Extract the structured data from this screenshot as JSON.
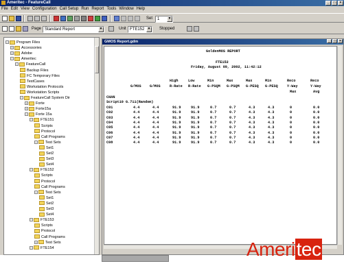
{
  "window": {
    "title": "Ameritec - FeatureCall"
  },
  "menu": [
    "File",
    "Edit",
    "View",
    "Configuration",
    "Call Setup",
    "Run",
    "Report",
    "Tools",
    "Window",
    "Help"
  ],
  "toolbar1": {
    "set_label": "Set",
    "set_value": "1"
  },
  "toolbar2": {
    "page_label": "Page",
    "page_value": "Standard Report",
    "unit_label": "Unit",
    "unit_value": "FTE152",
    "status": "Stopped"
  },
  "tree": {
    "items": [
      {
        "label": "Program Files",
        "indent": 1,
        "pm": "-"
      },
      {
        "label": "Accessories",
        "indent": 2,
        "pm": "+"
      },
      {
        "label": "Adobe",
        "indent": 2,
        "pm": "+"
      },
      {
        "label": "Ameritec",
        "indent": 2,
        "pm": "-"
      },
      {
        "label": "FeatureCall",
        "indent": 3,
        "pm": "-"
      },
      {
        "label": "Backup Files",
        "indent": 4,
        "pm": ""
      },
      {
        "label": "FC Temporary Files",
        "indent": 4,
        "pm": ""
      },
      {
        "label": "TestCases",
        "indent": 4,
        "pm": ""
      },
      {
        "label": "Workstation Protocols",
        "indent": 4,
        "pm": ""
      },
      {
        "label": "Workstation Scripts",
        "indent": 4,
        "pm": ""
      },
      {
        "label": "FeatureCall System Dir",
        "indent": 4,
        "pm": "-"
      },
      {
        "label": "Forte",
        "indent": 5,
        "pm": "+"
      },
      {
        "label": "Forte15a",
        "indent": 5,
        "pm": "+"
      },
      {
        "label": "Forte 15a",
        "indent": 5,
        "pm": "-"
      },
      {
        "label": "FTE151",
        "indent": 6,
        "pm": "-"
      },
      {
        "label": "Scripts",
        "indent": 7,
        "pm": ""
      },
      {
        "label": "Protocol",
        "indent": 7,
        "pm": ""
      },
      {
        "label": "Call Programs",
        "indent": 7,
        "pm": ""
      },
      {
        "label": "Test Sets",
        "indent": 7,
        "pm": "-"
      },
      {
        "label": "Set1",
        "indent": 8,
        "pm": ""
      },
      {
        "label": "Set2",
        "indent": 8,
        "pm": ""
      },
      {
        "label": "Set3",
        "indent": 8,
        "pm": ""
      },
      {
        "label": "Set4",
        "indent": 8,
        "pm": ""
      },
      {
        "label": "FTE152",
        "indent": 6,
        "pm": "-"
      },
      {
        "label": "Scripts",
        "indent": 7,
        "pm": ""
      },
      {
        "label": "Protocol",
        "indent": 7,
        "pm": ""
      },
      {
        "label": "Call Programs",
        "indent": 7,
        "pm": ""
      },
      {
        "label": "Test Sets",
        "indent": 7,
        "pm": "-"
      },
      {
        "label": "Set1",
        "indent": 8,
        "pm": ""
      },
      {
        "label": "Set2",
        "indent": 8,
        "pm": ""
      },
      {
        "label": "Set3",
        "indent": 8,
        "pm": ""
      },
      {
        "label": "Set4",
        "indent": 8,
        "pm": ""
      },
      {
        "label": "FTE153",
        "indent": 6,
        "pm": "-"
      },
      {
        "label": "Scripts",
        "indent": 7,
        "pm": ""
      },
      {
        "label": "Protocol",
        "indent": 7,
        "pm": ""
      },
      {
        "label": "Call Programs",
        "indent": 7,
        "pm": ""
      },
      {
        "label": "Test Sets",
        "indent": 7,
        "pm": "+"
      },
      {
        "label": "FTE154",
        "indent": 6,
        "pm": "-"
      }
    ]
  },
  "report": {
    "window_title": "GMOS Report.gdm",
    "heading": "GoldenMOS REPORT",
    "unit": "FTE152",
    "date": "Friday, August 09, 2002, 11:42:12",
    "columns": [
      {
        "l1": "",
        "l2": "",
        "l3": "G/MOS"
      },
      {
        "l1": "",
        "l2": "",
        "l3": "G/MOS"
      },
      {
        "l1": "High",
        "l2": "",
        "l3": "R-Rate"
      },
      {
        "l1": "Low",
        "l2": "",
        "l3": "R-Rate"
      },
      {
        "l1": "Min",
        "l2": "",
        "l3": "G-PSQM"
      },
      {
        "l1": "Max",
        "l2": "",
        "l3": "G-PSQM"
      },
      {
        "l1": "Max",
        "l2": "",
        "l3": "G-PESQ"
      },
      {
        "l1": "Min",
        "l2": "",
        "l3": "G-PESQ"
      },
      {
        "l1": "Reco",
        "l2": "",
        "l3": "Y-Way"
      },
      {
        "l1": "Reco",
        "l2": "",
        "l3": "Y-Way"
      }
    ],
    "sub_headers": [
      "Max",
      "Avg"
    ],
    "group_label": "CHAN",
    "script_label": "Script10 G.711(Random)",
    "rows": [
      {
        "ch": "C01",
        "v": [
          "4.4",
          "4.4",
          "91.9",
          "91.9",
          "0.7",
          "0.7",
          "4.3",
          "4.3",
          "0",
          "0.0"
        ]
      },
      {
        "ch": "C02",
        "v": [
          "4.4",
          "4.4",
          "91.9",
          "91.9",
          "0.7",
          "0.7",
          "4.3",
          "4.3",
          "0",
          "0.0"
        ]
      },
      {
        "ch": "C03",
        "v": [
          "4.4",
          "4.4",
          "91.9",
          "91.9",
          "0.7",
          "0.7",
          "4.3",
          "4.3",
          "0",
          "0.0"
        ]
      },
      {
        "ch": "C04",
        "v": [
          "4.4",
          "4.4",
          "91.9",
          "91.9",
          "0.7",
          "0.7",
          "4.3",
          "4.3",
          "0",
          "0.0"
        ]
      },
      {
        "ch": "C05",
        "v": [
          "4.4",
          "4.4",
          "91.9",
          "91.9",
          "0.7",
          "0.7",
          "4.3",
          "4.3",
          "0",
          "0.0"
        ]
      },
      {
        "ch": "C06",
        "v": [
          "4.4",
          "4.4",
          "91.9",
          "91.9",
          "0.7",
          "0.7",
          "4.3",
          "4.3",
          "0",
          "0.0"
        ]
      },
      {
        "ch": "C07",
        "v": [
          "4.4",
          "4.4",
          "91.9",
          "91.9",
          "0.7",
          "0.7",
          "4.3",
          "4.3",
          "0",
          "0.0"
        ]
      },
      {
        "ch": "C08",
        "v": [
          "4.4",
          "4.4",
          "91.9",
          "91.9",
          "0.7",
          "0.7",
          "4.3",
          "4.3",
          "0",
          "0.0"
        ]
      }
    ]
  },
  "logo": {
    "part1": "Ameri",
    "part2": "tec"
  }
}
